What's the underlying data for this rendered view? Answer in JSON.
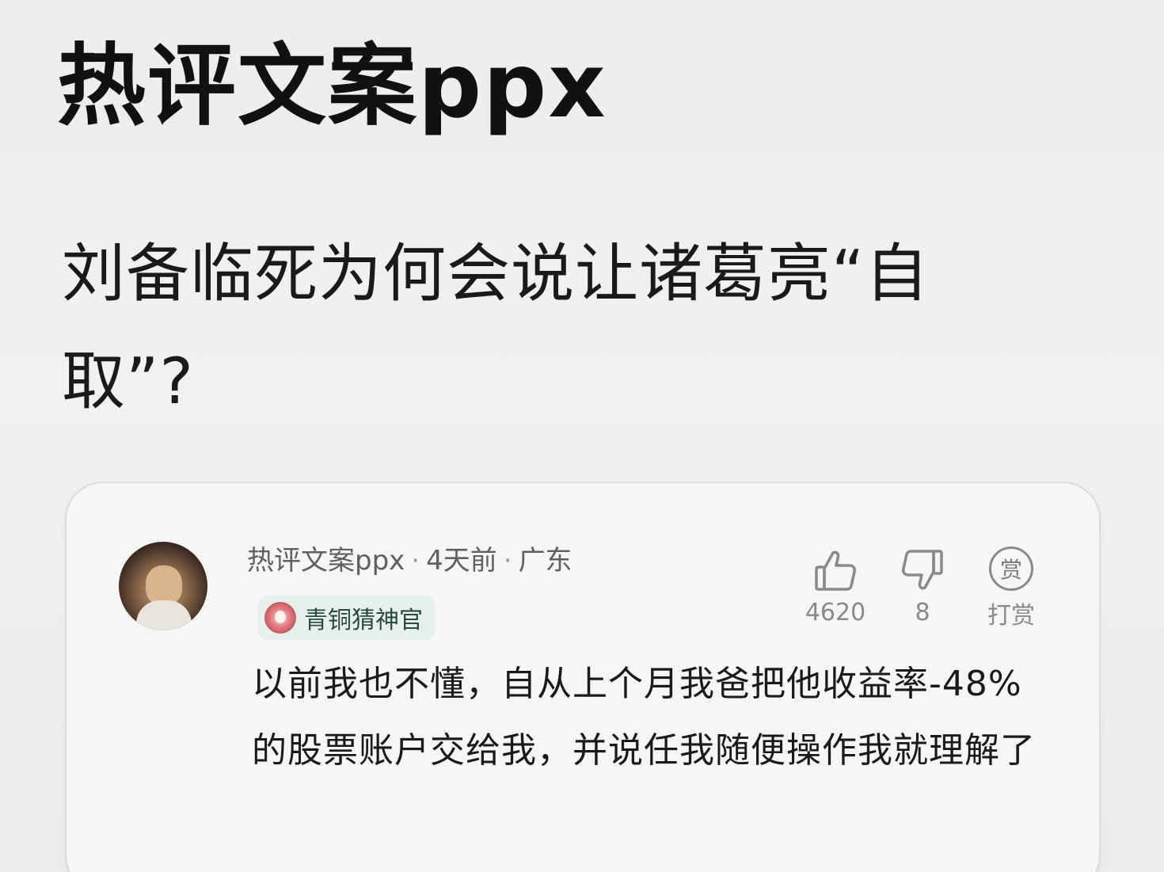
{
  "header": {
    "title": "热评文案ppx"
  },
  "post": {
    "question": "刘备临死为何会说让诸葛亮“自取”?"
  },
  "comment": {
    "author": "热评文案ppx",
    "time": "4天前",
    "location": "广东",
    "badge": "青铜猜神官",
    "text": "以前我也不懂，自从上个月我爸把他收益率-48%的股票账户交给我，并说任我随便操作我就理解了",
    "actions": {
      "like_count": "4620",
      "dislike_count": "8",
      "tip_glyph": "赏",
      "tip_label": "打赏"
    }
  },
  "icons": {
    "like": "thumbs-up-icon",
    "dislike": "thumbs-down-icon",
    "tip": "reward-icon",
    "badge": "flower-badge-icon"
  },
  "colors": {
    "background": "#eeeeec",
    "card": "#f6f6f4",
    "badge_bg": "#e7f1ec",
    "muted_text": "#8a8a8a"
  }
}
